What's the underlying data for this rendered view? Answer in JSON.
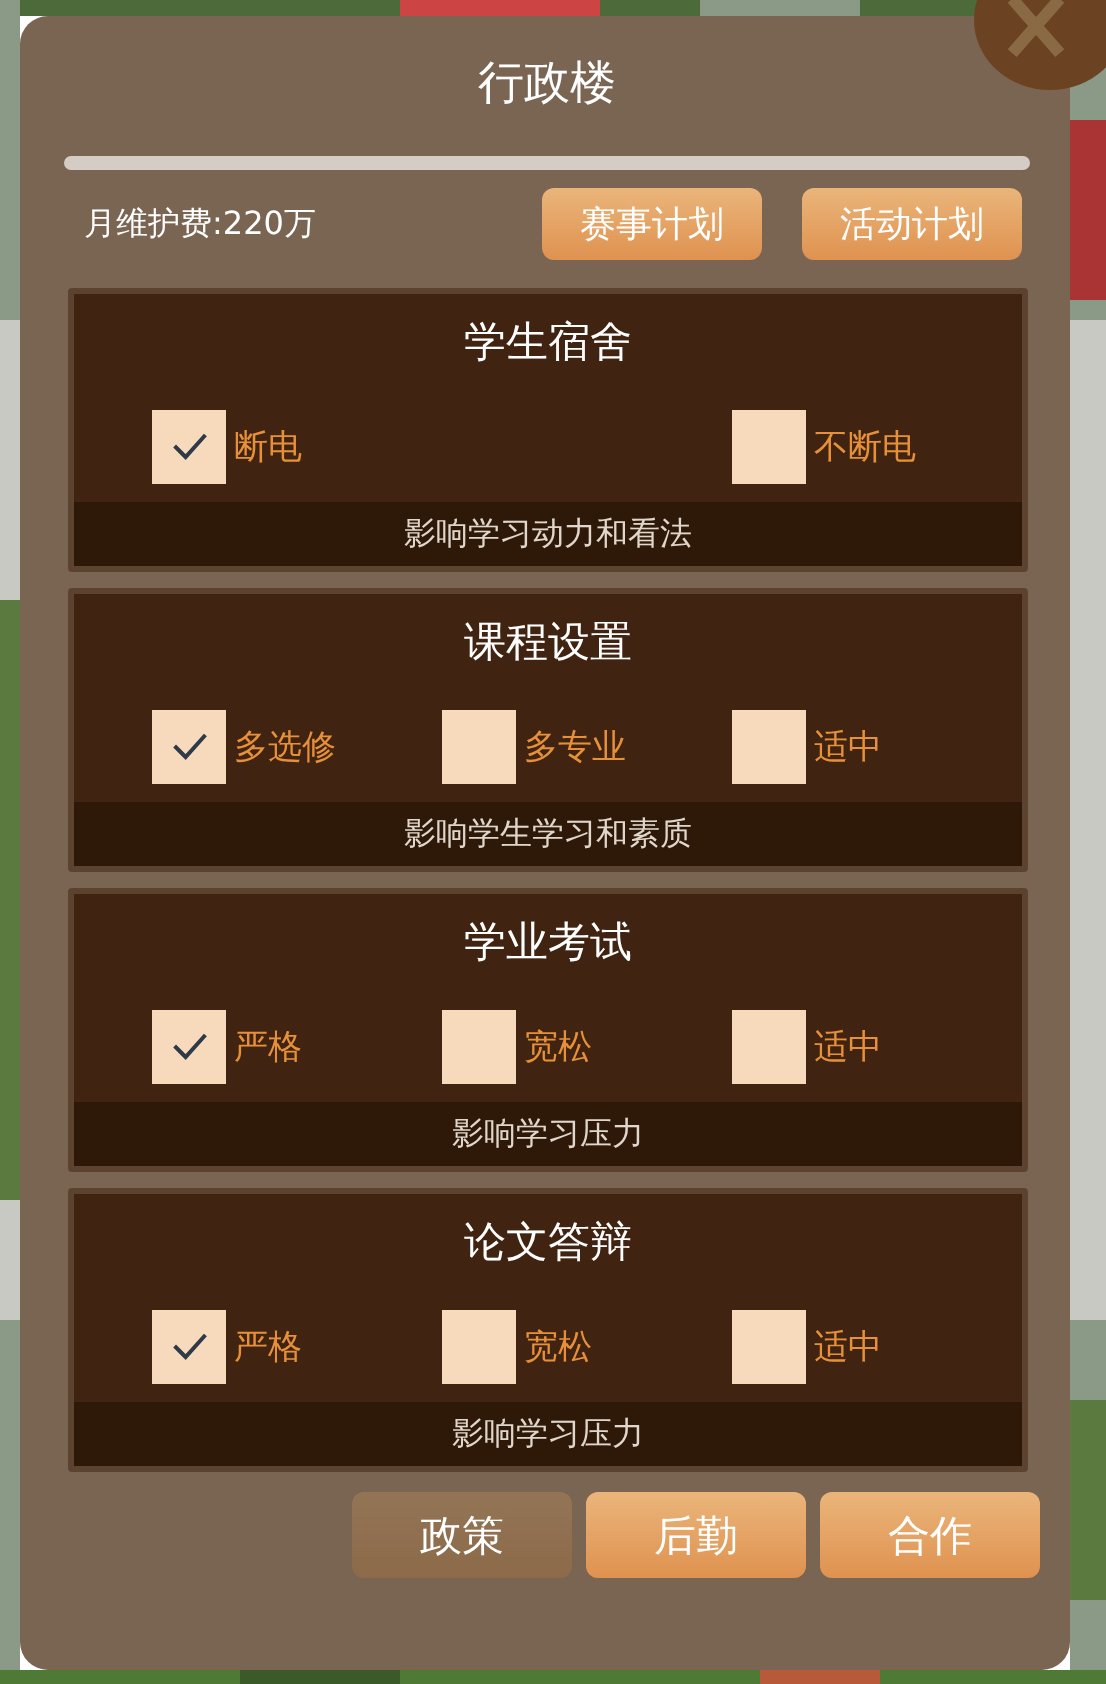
{
  "dialog": {
    "title": "行政楼",
    "maintenance": "月维护费:220万",
    "plan_buttons": [
      "赛事计划",
      "活动计划"
    ],
    "sections": [
      {
        "title": "学生宿舍",
        "options": [
          {
            "label": "断电",
            "checked": true
          },
          {
            "label": "不断电",
            "checked": false
          }
        ],
        "note": "影响学习动力和看法"
      },
      {
        "title": "课程设置",
        "options": [
          {
            "label": "多选修",
            "checked": true
          },
          {
            "label": "多专业",
            "checked": false
          },
          {
            "label": "适中",
            "checked": false
          }
        ],
        "note": "影响学生学习和素质"
      },
      {
        "title": "学业考试",
        "options": [
          {
            "label": "严格",
            "checked": true
          },
          {
            "label": "宽松",
            "checked": false
          },
          {
            "label": "适中",
            "checked": false
          }
        ],
        "note": "影响学习压力"
      },
      {
        "title": "论文答辩",
        "options": [
          {
            "label": "严格",
            "checked": true
          },
          {
            "label": "宽松",
            "checked": false
          },
          {
            "label": "适中",
            "checked": false
          }
        ],
        "note": "影响学习压力"
      }
    ],
    "tabs": [
      {
        "label": "政策",
        "selected": true
      },
      {
        "label": "后勤",
        "selected": false
      },
      {
        "label": "合作",
        "selected": false
      }
    ]
  }
}
